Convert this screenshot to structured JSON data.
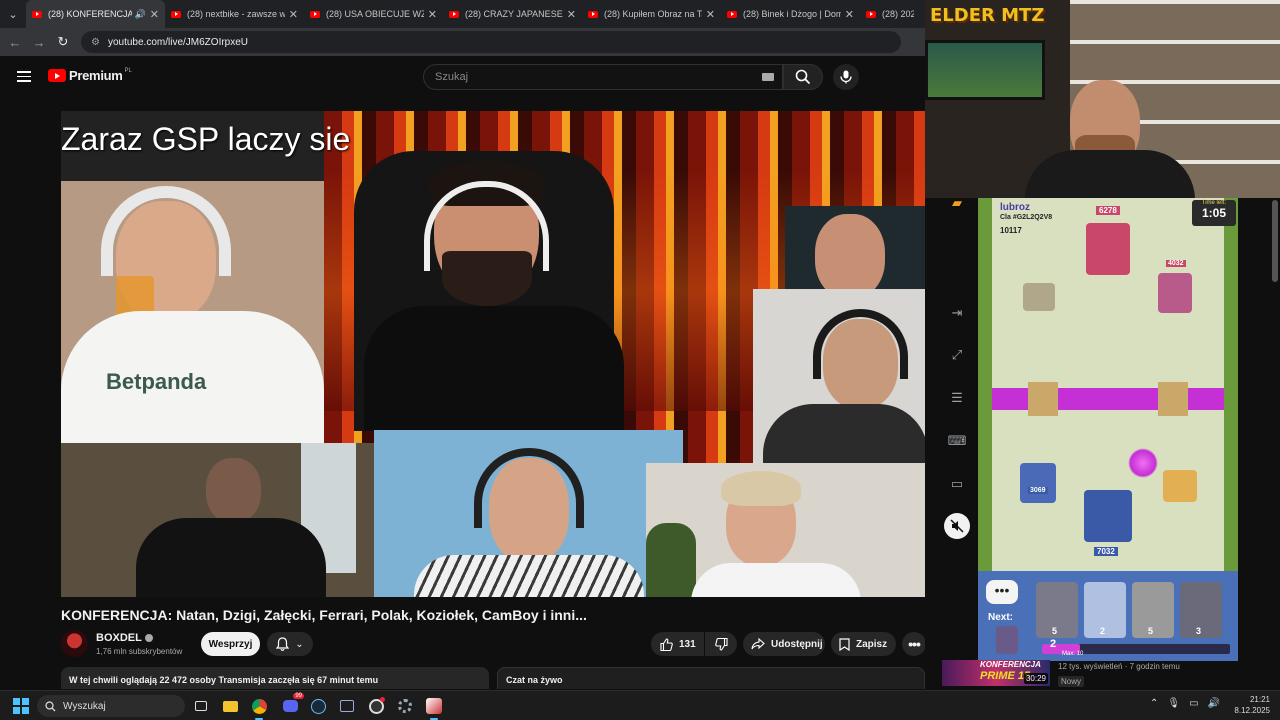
{
  "browser": {
    "tabs": [
      {
        "title": "(28) KONFERENCJA: N",
        "active": true,
        "audio": true
      },
      {
        "title": "(28) nextbike - zawsze wy"
      },
      {
        "title": "(28) USA OBIECUJE WZM"
      },
      {
        "title": "(28) CRAZY JAPANESE SIM"
      },
      {
        "title": "(28) Kupiłem Obraz na Ta"
      },
      {
        "title": "(28) Binek i Dżogo | Dom"
      },
      {
        "title": "(28) 2026 MC"
      }
    ],
    "url": "youtube.com/live/JM6ZOIrpxeU"
  },
  "youtube": {
    "logo_text": "Premium",
    "logo_region": "PL",
    "search_placeholder": "Szukaj"
  },
  "video": {
    "overlay_text": "Zaraz GSP laczy sie",
    "title": "KONFERENCJA: Natan, Dzigi, Załęcki, Ferrari, Polak, Koziołek, CamBoy i inni...",
    "channel": "BOXDEL",
    "subscribers": "1,76 mln subskrybentów",
    "join_label": "Wesprzyj",
    "likes": "131",
    "share_label": "Udostępnij",
    "save_label": "Zapisz",
    "live_status": "W tej chwili oglądają 22 472 osoby  Transmisja zaczęła się 67 minut temu",
    "chat_label": "Czat na żywo"
  },
  "overlay": {
    "streamer_logo": "ELDER MTZ"
  },
  "game": {
    "player_name": "lubroz",
    "player_tag": "Cla #G2L2Q2V8",
    "trophies": "10117",
    "time_left_label": "Time left:",
    "time_left": "1:05",
    "enemy_king_hp": "6278",
    "enemy_tower_hp": "4032",
    "friendly_left_tower_hp": "3069",
    "friendly_king_hp": "7032",
    "next_label": "Next:",
    "elixir": "2",
    "elixir_max": "Max: 10",
    "card_costs": [
      "5",
      "2",
      "5",
      "3"
    ]
  },
  "recommendation": {
    "thumb_text_top": "KONFERENCJA",
    "thumb_text_bottom": "PRIME 15",
    "duration": "30:29",
    "meta": "12 tys. wyświetleń · 7 godzin temu",
    "badge": "Nowy"
  },
  "taskbar": {
    "search_label": "Wyszukaj",
    "time": "21:21",
    "date": "8.12.2025",
    "discord_badge": "99"
  },
  "colors": {
    "yt_red": "#ff0000",
    "accent_blue": "#4cc2ff",
    "game_purple": "#c52fd6"
  }
}
